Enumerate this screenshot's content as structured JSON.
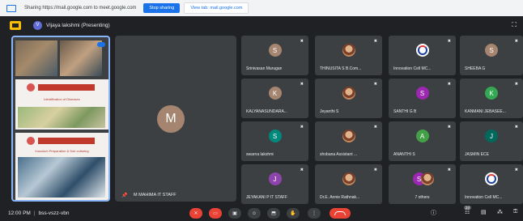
{
  "share_banner": {
    "text": "Sharing https://mail.google.com to meet.google.com",
    "stop_label": "Stop sharing",
    "view_tab_label": "View tab: mail.google.com"
  },
  "presenter": {
    "initial": "V",
    "name": "Vijaya lakshmi (Presenting)"
  },
  "share_preview": {
    "section_title": "Identification of Diseases",
    "section_subtitle": "Inoculum Preparation & Sub culturing"
  },
  "main_tile": {
    "initial": "M",
    "name": "M MAHIMA IT STAFF"
  },
  "participants": [
    {
      "initial": "S",
      "name": "Srinivasan Murugan",
      "color": "#a5856f",
      "kind": "letter"
    },
    {
      "initial": "",
      "name": "THINUSITA S B.Com...",
      "color": "",
      "kind": "photo"
    },
    {
      "initial": "",
      "name": "Innovation Cell MC...",
      "color": "",
      "kind": "logo"
    },
    {
      "initial": "S",
      "name": "SHEEBA G",
      "color": "#a5856f",
      "kind": "letter"
    },
    {
      "initial": "K",
      "name": "KALYANASUNDARA...",
      "color": "#a5856f",
      "kind": "letter"
    },
    {
      "initial": "",
      "name": "Jeyanthi S",
      "color": "",
      "kind": "photo"
    },
    {
      "initial": "S",
      "name": "SANTHI G B",
      "color": "#9c27b0",
      "kind": "letter"
    },
    {
      "initial": "K",
      "name": "KANMANI JEBASEE...",
      "color": "#34a853",
      "kind": "letter"
    },
    {
      "initial": "S",
      "name": "swarna lakshmi",
      "color": "#00897b",
      "kind": "letter"
    },
    {
      "initial": "",
      "name": "shobana Assistant ...",
      "color": "",
      "kind": "photo"
    },
    {
      "initial": "A",
      "name": "ANANTHI S",
      "color": "#43a047",
      "kind": "letter"
    },
    {
      "initial": "J",
      "name": "JASMIN ECE",
      "color": "#00695c",
      "kind": "letter"
    },
    {
      "initial": "J",
      "name": "JEYAKANI P IT STAFF",
      "color": "#8e44ad",
      "kind": "letter"
    },
    {
      "initial": "",
      "name": "Dr.E. Annie Rathnak...",
      "color": "",
      "kind": "photo"
    },
    {
      "initial": "S",
      "name": "7 others",
      "color": "#9c27b0",
      "kind": "others"
    },
    {
      "initial": "",
      "name": "Innovation Cell MC...",
      "color": "",
      "kind": "logo"
    }
  ],
  "bottom": {
    "time": "12:00 PM",
    "separator": "|",
    "meeting_code": "bss-vszz-vbn",
    "people_count": "24"
  }
}
